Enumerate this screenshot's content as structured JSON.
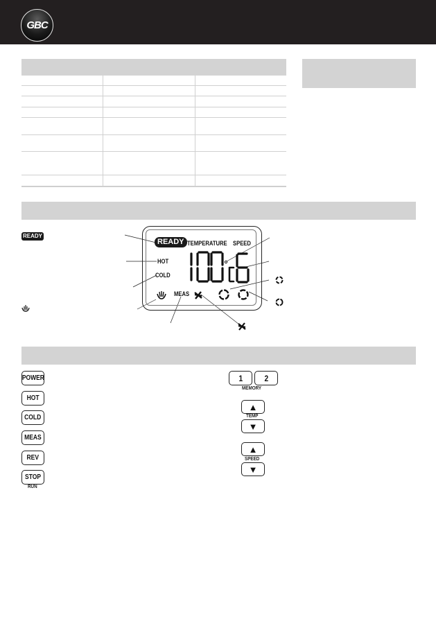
{
  "header": {
    "brand": "GBC",
    "logo_icon": "gbc-logo"
  },
  "spec_table": {
    "columns": 3,
    "rows": [
      [
        "",
        "",
        ""
      ],
      [
        "",
        "",
        ""
      ],
      [
        "",
        "",
        ""
      ],
      [
        "",
        "",
        ""
      ],
      [
        "",
        "",
        ""
      ],
      [
        "",
        "",
        ""
      ],
      [
        "",
        "",
        ""
      ],
      [
        "",
        "",
        ""
      ]
    ]
  },
  "display_section": {
    "legend": {
      "ready_badge": "READY",
      "heat_icon": "heater-icon",
      "circle_icon_1": "dashed-circle-icon",
      "circle_icon_2": "segmented-circle-icon",
      "fan_icon": "fan-icon"
    },
    "lcd": {
      "ready": "READY",
      "temperature": "TEMPERATURE",
      "speed": "SPEED",
      "hot": "HOT",
      "cold": "COLD",
      "meas": "MEAS",
      "temp_value": "100",
      "degree": "°",
      "unit": "c",
      "speed_value": "6"
    }
  },
  "controls_section": {
    "left_keys": [
      {
        "label": "POWER"
      },
      {
        "label": "HOT"
      },
      {
        "label": "COLD"
      },
      {
        "label": "MEAS"
      },
      {
        "label": "REV"
      },
      {
        "label": "STOP",
        "sublabel": "RUN"
      }
    ],
    "memory": {
      "keys": [
        "1",
        "2"
      ],
      "label": "MEMORY"
    },
    "temp": {
      "up": "▲",
      "down": "▼",
      "label": "TEMP"
    },
    "speed": {
      "up": "▲",
      "down": "▼",
      "label": "SPEED"
    }
  }
}
